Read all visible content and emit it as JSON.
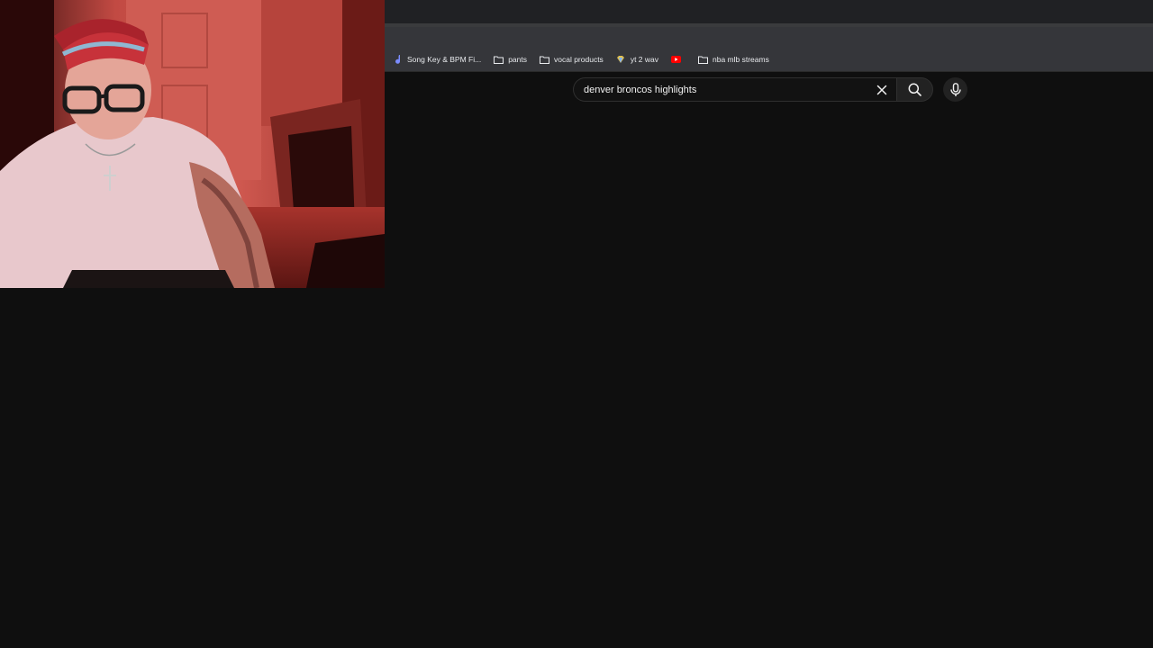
{
  "browser": {
    "bookmarks": [
      {
        "icon": "note-icon",
        "label": "Song Key & BPM Fi..."
      },
      {
        "icon": "folder-icon",
        "label": "pants"
      },
      {
        "icon": "folder-icon",
        "label": "vocal products"
      },
      {
        "icon": "diamond-icon",
        "label": "yt 2 wav"
      },
      {
        "icon": "youtube-icon",
        "label": ""
      },
      {
        "icon": "folder-icon",
        "label": "nba mlb streams"
      }
    ]
  },
  "search": {
    "query": "denver broncos highlights",
    "clear_icon": "close-icon",
    "search_icon": "search-icon",
    "mic_icon": "microphone-icon"
  },
  "webcam": {
    "description_icon": "webcam-feed"
  },
  "colors": {
    "background": "#0f0f0f",
    "chrome": "#35363a",
    "youtube_red": "#ff0000"
  }
}
